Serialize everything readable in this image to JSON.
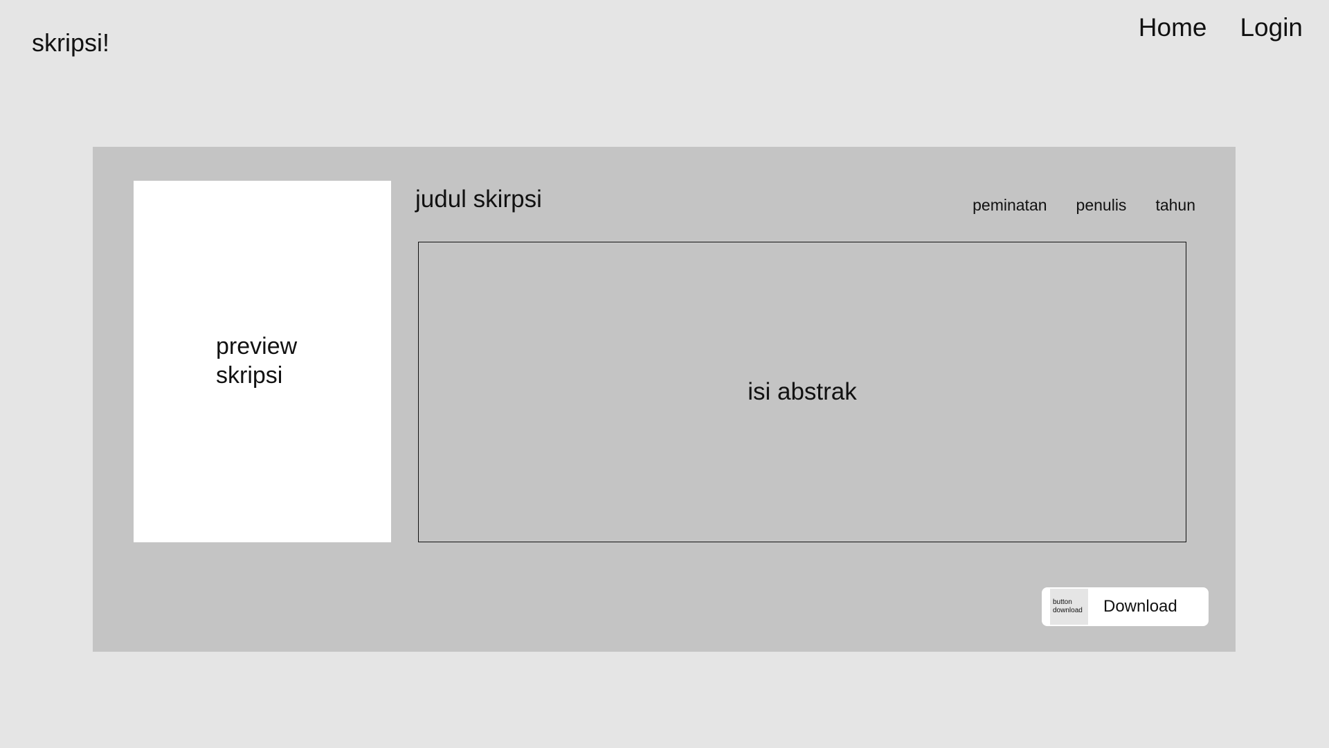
{
  "header": {
    "brand": "skripsi!",
    "nav": [
      {
        "label": "Home"
      },
      {
        "label": "Login"
      }
    ]
  },
  "detail": {
    "preview_label": "preview\nskripsi",
    "title": "judul skirpsi",
    "meta": [
      "peminatan",
      "penulis",
      "tahun"
    ],
    "abstract": "isi abstrak",
    "download": {
      "icon_line1": "button",
      "icon_line2": "download",
      "label": "Download"
    }
  }
}
